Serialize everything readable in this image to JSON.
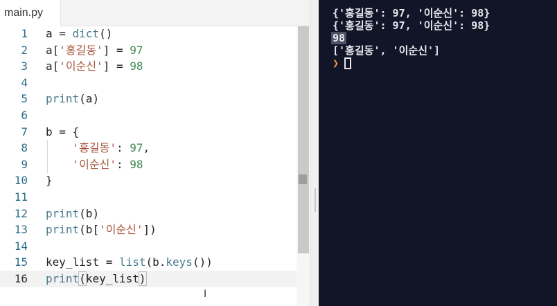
{
  "editor": {
    "tab_title": "main.py",
    "lines": [
      {
        "n": "1",
        "tokens": [
          [
            "",
            "a = "
          ],
          [
            "fn",
            "dict"
          ],
          [
            "",
            "()"
          ]
        ]
      },
      {
        "n": "2",
        "tokens": [
          [
            "",
            "a["
          ],
          [
            "str",
            "'홍길동'"
          ],
          [
            "",
            "] = "
          ],
          [
            "num",
            "97"
          ]
        ]
      },
      {
        "n": "3",
        "tokens": [
          [
            "",
            "a["
          ],
          [
            "str",
            "'이순신'"
          ],
          [
            "",
            "] = "
          ],
          [
            "num",
            "98"
          ]
        ]
      },
      {
        "n": "4",
        "tokens": []
      },
      {
        "n": "5",
        "tokens": [
          [
            "fn",
            "print"
          ],
          [
            "",
            "(a)"
          ]
        ]
      },
      {
        "n": "6",
        "tokens": []
      },
      {
        "n": "7",
        "tokens": [
          [
            "",
            "b = {"
          ]
        ]
      },
      {
        "n": "8",
        "tokens": [
          [
            "",
            "    "
          ],
          [
            "str",
            "'홍길동'"
          ],
          [
            "",
            ": "
          ],
          [
            "num",
            "97"
          ],
          [
            "",
            ","
          ]
        ]
      },
      {
        "n": "9",
        "tokens": [
          [
            "",
            "    "
          ],
          [
            "str",
            "'이순신'"
          ],
          [
            "",
            ": "
          ],
          [
            "num",
            "98"
          ]
        ]
      },
      {
        "n": "10",
        "tokens": [
          [
            "",
            "}"
          ]
        ]
      },
      {
        "n": "11",
        "tokens": []
      },
      {
        "n": "12",
        "tokens": [
          [
            "fn",
            "print"
          ],
          [
            "",
            "(b)"
          ]
        ]
      },
      {
        "n": "13",
        "tokens": [
          [
            "fn",
            "print"
          ],
          [
            "",
            "(b["
          ],
          [
            "str",
            "'이순신'"
          ],
          [
            "",
            "])"
          ]
        ]
      },
      {
        "n": "14",
        "tokens": []
      },
      {
        "n": "15",
        "tokens": [
          [
            "",
            "key_list = "
          ],
          [
            "fn",
            "list"
          ],
          [
            "",
            "(b."
          ],
          [
            "fn",
            "keys"
          ],
          [
            "",
            "())"
          ]
        ]
      },
      {
        "n": "16",
        "tokens": [
          [
            "fn",
            "print"
          ],
          [
            "bm",
            "("
          ],
          [
            "",
            "key_list"
          ],
          [
            "bm",
            ")"
          ]
        ],
        "active": true
      }
    ]
  },
  "console": {
    "output": [
      "{'홍길동': 97, '이순신': 98}",
      "{'홍길동': 97, '이순신': 98}",
      "98",
      "['홍길동', '이순신']"
    ],
    "prompt_symbol": "❯"
  },
  "colors": {
    "console_bg": "#121528",
    "string": "#a8553c",
    "number": "#3d8a4e",
    "builtin": "#4a7a8c",
    "line_number": "#2d6e8a",
    "prompt": "#f29447"
  }
}
